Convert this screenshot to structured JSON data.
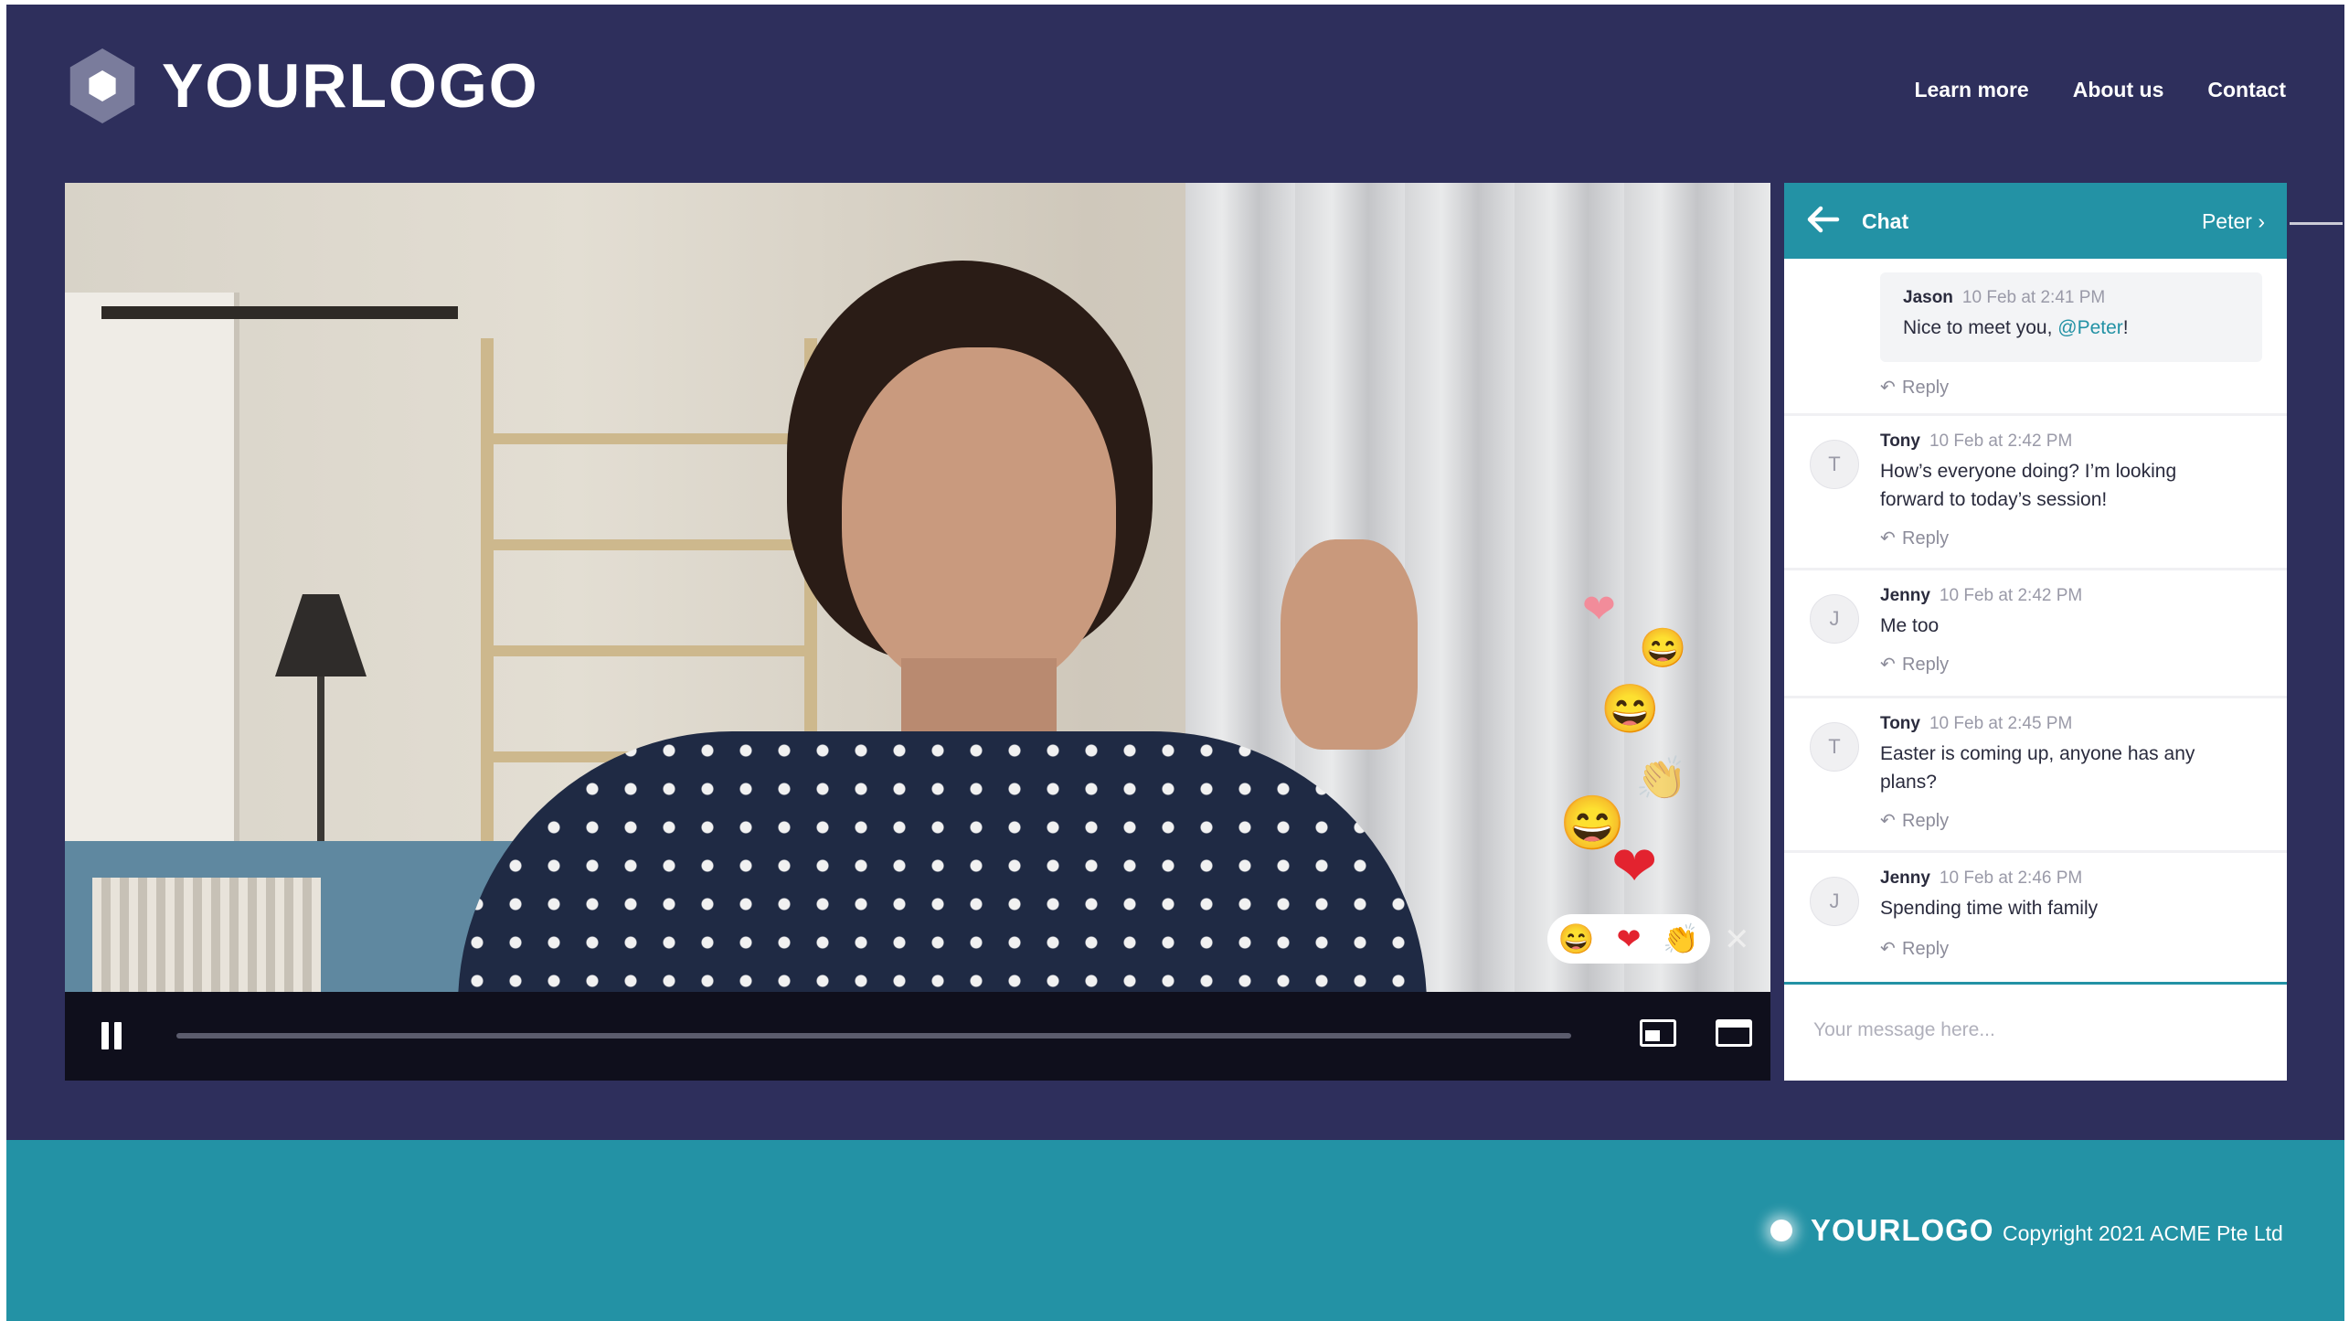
{
  "header": {
    "logo_text": "YOURLOGO",
    "nav": [
      {
        "label": "Learn more"
      },
      {
        "label": "About us"
      },
      {
        "label": "Contact"
      }
    ]
  },
  "video": {
    "state": "playing",
    "progress_fraction": 0,
    "reaction_icons": [
      "smiley-icon",
      "heart-icon",
      "clapping-hands-icon"
    ],
    "controls": {
      "play_pause_icon": "pause-icon",
      "mini_player_icon": "picture-in-picture-icon",
      "fullscreen_icon": "fullscreen-icon"
    }
  },
  "chat": {
    "title": "Chat",
    "peer": "Peer",
    "peer_name": "Peter",
    "reply_label": "Reply",
    "input_placeholder": "Your message here...",
    "messages": [
      {
        "author": "Jason",
        "time": "10 Feb at 2:41 PM",
        "text": "Nice to meet you,",
        "mention": "@Peter",
        "suffix": "!",
        "own": true
      },
      {
        "author": "Tony",
        "initial": "T",
        "time": "10 Feb at 2:42 PM",
        "text": "How’s everyone doing? I’m looking forward to today’s session!"
      },
      {
        "author": "Jenny",
        "initial": "J",
        "time": "10 Feb at 2:42 PM",
        "text": "Me too"
      },
      {
        "author": "Tony",
        "initial": "T",
        "time": "10 Feb at 2:45 PM",
        "text": "Easter is coming up, anyone has any plans?"
      },
      {
        "author": "Jenny",
        "initial": "J",
        "time": "10 Feb at 2:46 PM",
        "text": "Spending time with family"
      }
    ]
  },
  "footer": {
    "logo_text": "YOURLOGO",
    "copyright": "Copyright 2021 ACME Pte Ltd"
  },
  "colors": {
    "header_background": "#2e2f5c",
    "accent_teal": "#2392a5",
    "video_controls_background": "#0f0f1c"
  }
}
